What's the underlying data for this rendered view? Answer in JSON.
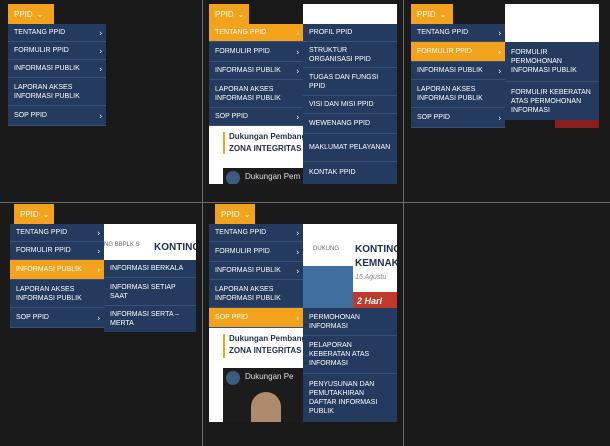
{
  "pane1": {
    "ppid": "PPID",
    "items": [
      "TENTANG PPID",
      "FORMULIR PPID",
      "INFORMASI PUBLIK",
      "LAPORAN AKSES INFORMASI PUBLIK",
      "SOP PPID"
    ]
  },
  "pane2": {
    "ppid": "PPID",
    "items": [
      "TENTANG PPID",
      "FORMULIR PPID",
      "INFORMASI PUBLIK",
      "LAPORAN AKSES INFORMASI PUBLIK",
      "SOP PPID"
    ],
    "sub": [
      "PROFIL PPID",
      "STRUKTUR ORGANISASI PPID",
      "TUGAS DAN FUNGSI PPID",
      "VISI DAN MISI PPID",
      "WEWENANG PPID",
      "MAKLUMAT PELAYANAN",
      "KONTAK PPID"
    ],
    "card_title": "Dukungan Pembang... ZONA INTEGRITAS",
    "card_line1": "Dukungan Pembang",
    "card_line2": "ZONA INTEGRITAS",
    "video_text": "Dukungan Pem"
  },
  "pane3": {
    "ppid": "PPID",
    "items": [
      "TENTANG PPID",
      "FORMULIR PPID",
      "INFORMASI PUBLIK",
      "LAPORAN AKSES INFORMASI PUBLIK",
      "SOP PPID"
    ],
    "sub": [
      "FORMULIR PERMOHONAN INFORMASI PUBLIK",
      "FORMULIR KEBERATAN ATAS PERMOHONAN INFORMASI"
    ]
  },
  "pane4": {
    "ppid": "PPID",
    "items": [
      "TENTANG PPID",
      "FORMULIR PPID",
      "INFORMASI PUBLIK",
      "LAPORAN AKSES INFORMASI PUBLIK",
      "SOP PPID"
    ],
    "sub": [
      "INFORMASI BERKALA",
      "INFORMASI SETIAP SAAT",
      "INFORMASI SERTA – MERTA"
    ],
    "ticker": "NG BBPLK S",
    "headline": "KONTING"
  },
  "pane5": {
    "ppid": "PPID",
    "items": [
      "TENTANG PPID",
      "FORMULIR PPID",
      "INFORMASI PUBLIK",
      "LAPORAN AKSES INFORMASI PUBLIK",
      "SOP PPID"
    ],
    "sub": [
      "PERMOHONAN INFORMASI",
      "PELAPORAN KEBERATAN ATAS INFORMASI",
      "PENYUSUNAN DAN PEMUTAKHIRAN DAFTAR INFORMASI PUBLIK"
    ],
    "ticker": "DUKUNG",
    "headline1": "KONTING",
    "headline2": "KEMNAK",
    "date": "15 Agustu",
    "banner": "2 Harl",
    "card_line1": "Dukungan Pembang",
    "card_line2": "ZONA INTEGRITAS",
    "video_text": "Dukungan Pe"
  }
}
